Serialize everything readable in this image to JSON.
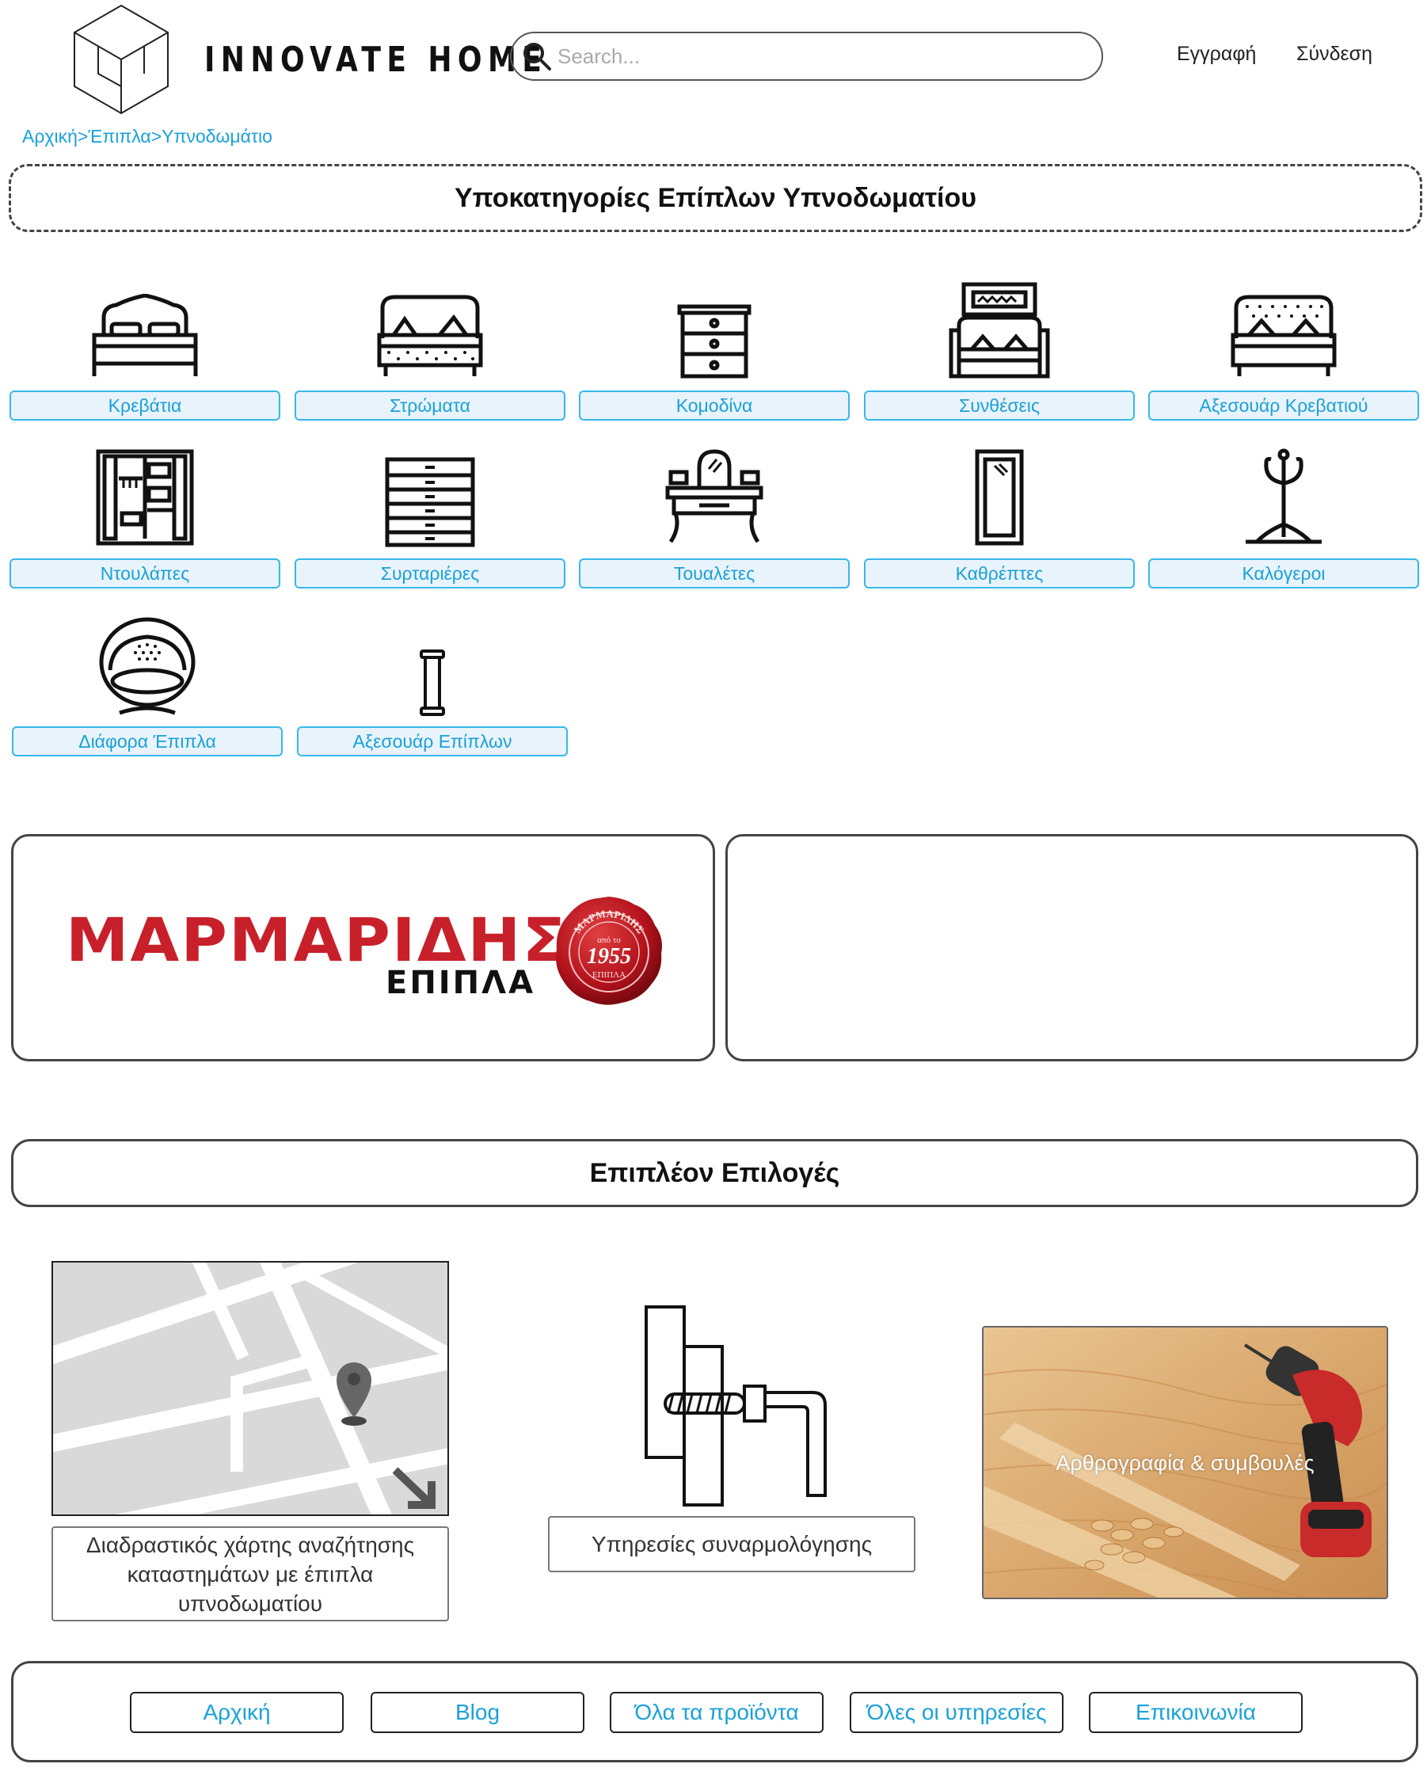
{
  "header": {
    "brand": "INNOVATE HOME",
    "search_placeholder": "Search...",
    "register_label": "Εγγραφή",
    "login_label": "Σύνδεση"
  },
  "breadcrumb": [
    "Αρχική",
    "Έπιπλα",
    "Υπνοδωμάτιο"
  ],
  "breadcrumb_separator": ">",
  "subcategories_title": "Υποκατηγορίες Επίπλων Υπνοδωματίου",
  "categories": [
    {
      "label": "Κρεβάτια",
      "icon": "bed-icon"
    },
    {
      "label": "Στρώματα",
      "icon": "mattress-icon"
    },
    {
      "label": "Κομοδίνα",
      "icon": "nightstand-icon"
    },
    {
      "label": "Συνθέσεις",
      "icon": "bedroom-set-icon"
    },
    {
      "label": "Αξεσουάρ Κρεβατιού",
      "icon": "bed-accessories-icon"
    },
    {
      "label": "Ντουλάπες",
      "icon": "wardrobe-icon"
    },
    {
      "label": "Συρταριέρες",
      "icon": "chest-of-drawers-icon"
    },
    {
      "label": "Τουαλέτες",
      "icon": "dressing-table-icon"
    },
    {
      "label": "Καθρέπτες",
      "icon": "mirror-icon"
    },
    {
      "label": "Καλόγεροι",
      "icon": "coat-stand-icon"
    },
    {
      "label": "Διάφορα Έπιπλα",
      "icon": "egg-chair-icon"
    },
    {
      "label": "Αξεσουάρ Επίπλων",
      "icon": "furniture-accessory-icon"
    }
  ],
  "banner": {
    "brand_name": "ΜΑΡΜΑΡΙΔΗΣ",
    "brand_sub": "ΕΠΙΠΛΑ",
    "seal_name": "ΜΑΡΜΑΡΙΔΗΣ",
    "seal_since": "από το",
    "seal_year": "1955",
    "seal_sub": "ΕΠΙΠΛΑ",
    "brand_color": "#c8202b"
  },
  "extra_title": "Επιπλέον Επιλογές",
  "options": {
    "map_label": "Διαδραστικός χάρτης αναζήτησης καταστημάτων με έπιπλα υπνοδωματίου",
    "assembly_label": "Υπηρεσίες συναρμολόγησης",
    "article_label": "Αρθρογραφία & συμβουλές"
  },
  "footer": [
    "Αρχική",
    "Blog",
    "Όλα τα προϊόντα",
    "Όλες οι υπηρεσίες",
    "Επικοινωνία"
  ],
  "colors": {
    "accent": "#1aa1d8",
    "button_bg": "#e9f3fc",
    "button_border": "#38b8e8"
  }
}
